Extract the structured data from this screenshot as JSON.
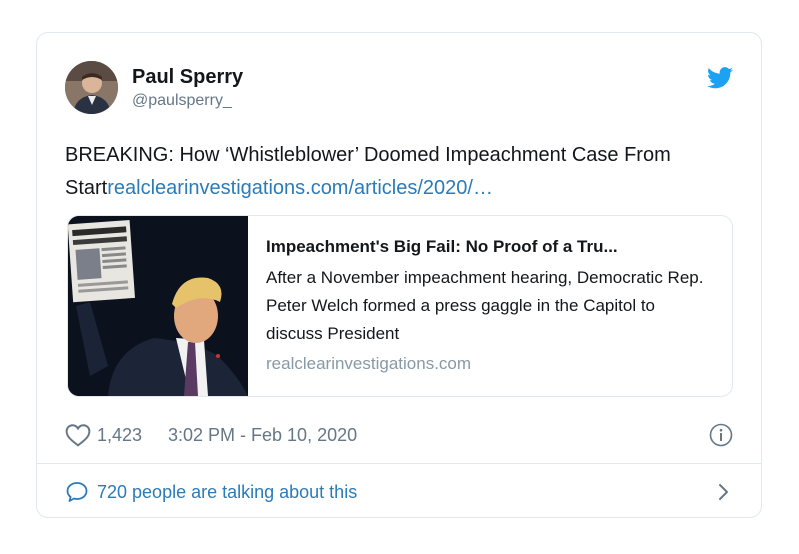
{
  "author": {
    "display_name": "Paul Sperry",
    "handle": "@paulsperry_",
    "avatar_icon": "user-avatar"
  },
  "tweet": {
    "text": "BREAKING: How ‘Whistleblower’ Doomed Impeachment Case From Start",
    "link_text": "realclearinvestigations.com/articles/2020/…"
  },
  "link_card": {
    "title": "Impeachment's Big Fail: No Proof of a Tru...",
    "description": "After a November impeachment hearing, Democratic Rep. Peter Welch formed a press gaggle in the Capitol to discuss President",
    "domain": "realclearinvestigations.com"
  },
  "meta": {
    "likes": "1,423",
    "timestamp": "3:02 PM - Feb 10, 2020"
  },
  "footer": {
    "talking": "720 people are talking about this"
  },
  "colors": {
    "link": "#2b7bb9",
    "twitter_blue": "#1da1f2",
    "secondary_text": "#657786"
  },
  "icons": [
    "twitter-bird-icon",
    "heart-icon",
    "info-icon",
    "comment-icon",
    "chevron-right-icon"
  ]
}
